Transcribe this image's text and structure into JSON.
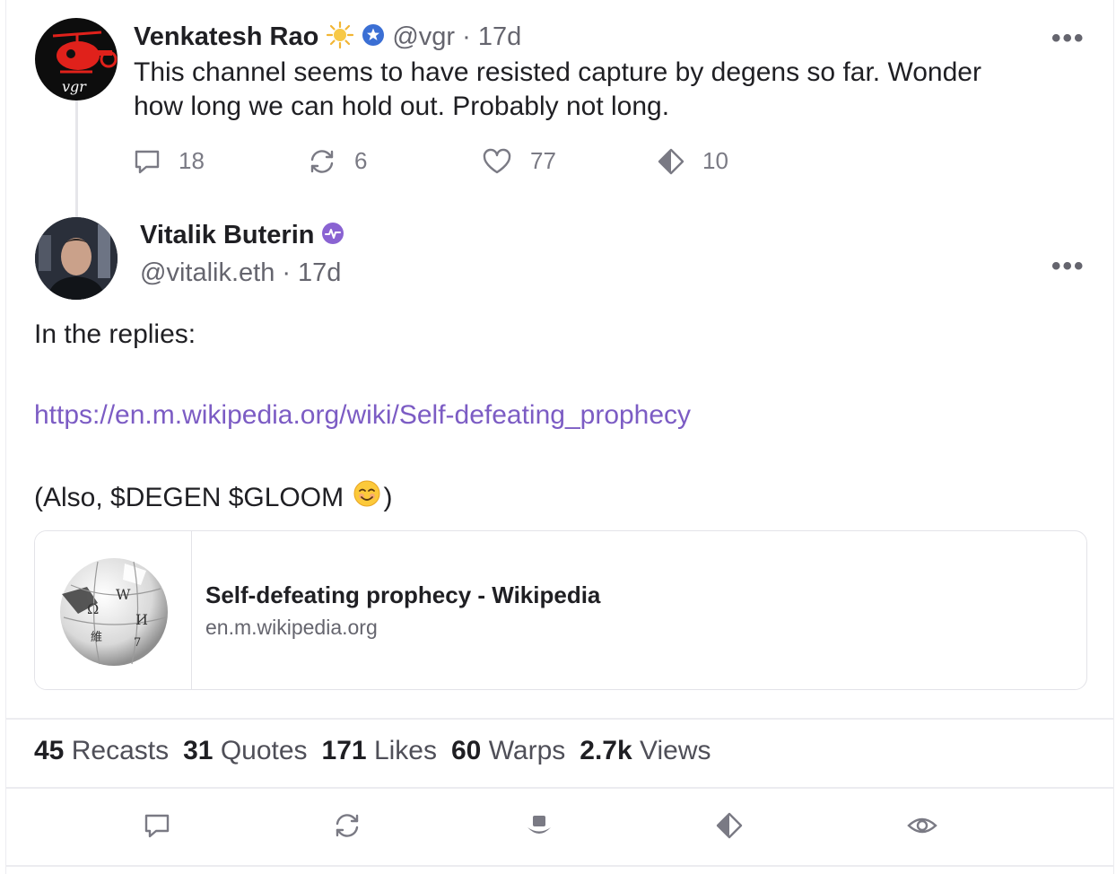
{
  "parent": {
    "author_name": "Venkatesh Rao",
    "handle_time": "@vgr · 17d",
    "text_line1": "This channel seems to have  resisted capture by degens so far. Wonder",
    "text_line2": "how long we can hold out. Probably not long.",
    "avatar_text": "vgr",
    "actions": {
      "replies": "18",
      "recasts": "6",
      "likes": "77",
      "warps": "10"
    }
  },
  "main": {
    "author_name": "Vitalik Buterin",
    "handle": "@vitalik.eth",
    "time": "· 17d",
    "line1": "In the replies:",
    "link": "https://en.m.wikipedia.org/wiki/Self-defeating_prophecy",
    "line3": "(Also, $DEGEN $GLOOM ",
    "line3_end": ")",
    "embed": {
      "title": "Self-defeating prophecy - Wikipedia",
      "domain": "en.m.wikipedia.org"
    },
    "stats": [
      {
        "value": "45",
        "label": "Recasts"
      },
      {
        "value": "31",
        "label": "Quotes"
      },
      {
        "value": "171",
        "label": "Likes"
      },
      {
        "value": "60",
        "label": "Warps"
      },
      {
        "value": "2.7k",
        "label": "Views"
      }
    ]
  },
  "colors": {
    "accent": "#7c5cc4",
    "verified_blue": "#3b6fd4",
    "sun": "#f2b534"
  },
  "icons": [
    "reply-icon",
    "recast-icon",
    "like-icon",
    "warp-icon",
    "more-icon",
    "verified-icon",
    "power-badge-icon",
    "sun-icon",
    "hat-icon",
    "view-icon",
    "smile-emoji-icon"
  ]
}
